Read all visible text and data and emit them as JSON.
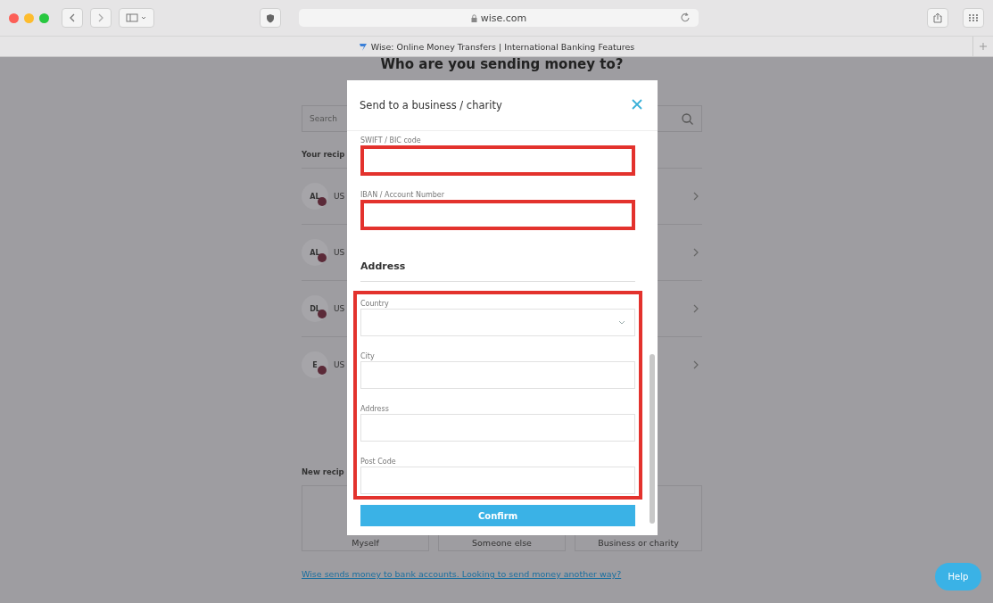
{
  "browser": {
    "url": "wise.com",
    "tab_title": "Wise: Online Money Transfers | International Banking Features"
  },
  "page": {
    "heading": "Who are you sending money to?",
    "search": {
      "placeholder": "Search"
    },
    "recipients_label": "Your recip",
    "recipients": [
      {
        "initials": "AL",
        "currency": "US"
      },
      {
        "initials": "AL",
        "currency": "US"
      },
      {
        "initials": "DL",
        "currency": "US"
      },
      {
        "initials": "E",
        "currency": "US"
      }
    ],
    "new_label": "New recip",
    "new_options": [
      "Myself",
      "Someone else",
      "Business or charity"
    ],
    "link": "Wise sends money to bank accounts. Looking to send money another way?"
  },
  "modal": {
    "title": "Send to a business / charity",
    "bank_fields": [
      {
        "label": "SWIFT / BIC code",
        "highlighted": true
      },
      {
        "label": "IBAN / Account Number",
        "highlighted": true
      }
    ],
    "address": {
      "heading": "Address",
      "highlighted": true,
      "fields": [
        {
          "kind": "select",
          "label": "Country"
        },
        {
          "kind": "text",
          "label": "City"
        },
        {
          "kind": "text",
          "label": "Address"
        },
        {
          "kind": "text",
          "label": "Post Code"
        }
      ]
    },
    "button": "Confirm"
  },
  "help_button": "Help"
}
